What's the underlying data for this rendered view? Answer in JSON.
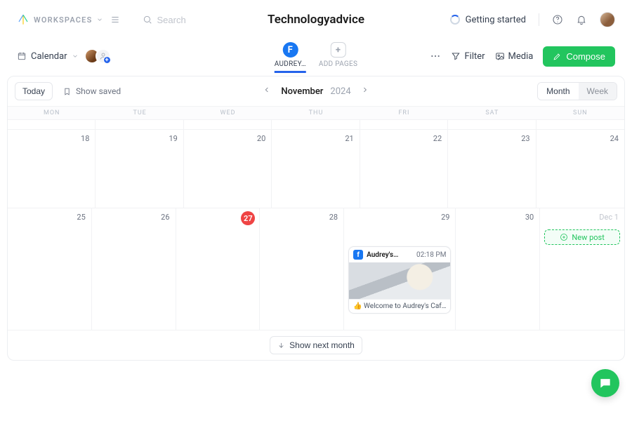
{
  "brand": {
    "label": "WORKSPACES"
  },
  "search": {
    "placeholder": "Search"
  },
  "page_title": "Technologyadvice",
  "top": {
    "getting_started": "Getting started"
  },
  "subbar": {
    "section_label": "Calendar",
    "tabs": [
      {
        "label": "Audrey…"
      },
      {
        "label": "ADD PAGES"
      }
    ],
    "filter": "Filter",
    "media": "Media",
    "compose": "Compose"
  },
  "panel": {
    "today": "Today",
    "show_saved": "Show saved",
    "month": "November",
    "year": "2024",
    "view_month": "Month",
    "view_week": "Week",
    "dow": [
      "MON",
      "TUE",
      "WED",
      "THU",
      "FRI",
      "SAT",
      "SUN"
    ],
    "week1": [
      "18",
      "19",
      "20",
      "21",
      "22",
      "23",
      "24"
    ],
    "week2": [
      "25",
      "26",
      "27",
      "28",
      "29",
      "30",
      "Dec 1"
    ],
    "new_post_label": "New post",
    "show_next": "Show next month"
  },
  "post": {
    "account": "Audrey's…",
    "time": "02:18 PM",
    "caption_prefix": "👍",
    "caption": "Welcome to Audrey's Caf…"
  }
}
